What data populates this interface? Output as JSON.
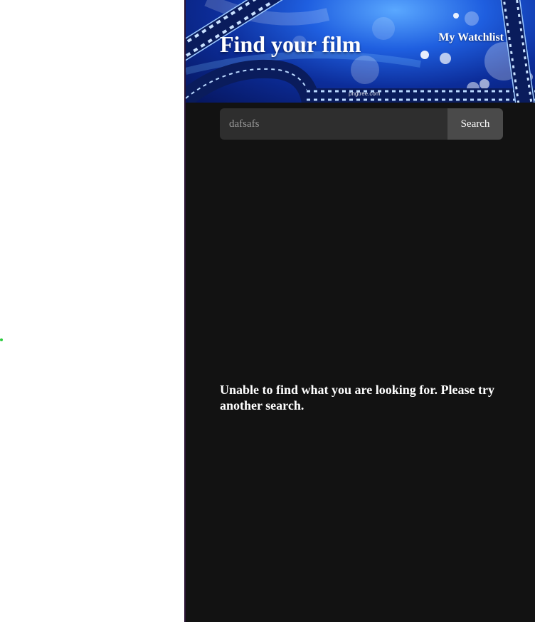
{
  "header": {
    "title": "Find your film",
    "watchlist_link": "My Watchlist",
    "banner_watermark": "pngtree.com",
    "banner_colors": [
      "#0c2d9a",
      "#1f5fe0",
      "#5aa8ff"
    ]
  },
  "search": {
    "value": "dafsafs",
    "placeholder": "",
    "button_label": "Search"
  },
  "results": {
    "empty_message": "Unable to find what you are looking for. Please try another search."
  },
  "colors": {
    "app_background": "#121212",
    "input_background": "#2e2e2e",
    "button_background": "#4a4a4a",
    "text": "#ffffff"
  }
}
